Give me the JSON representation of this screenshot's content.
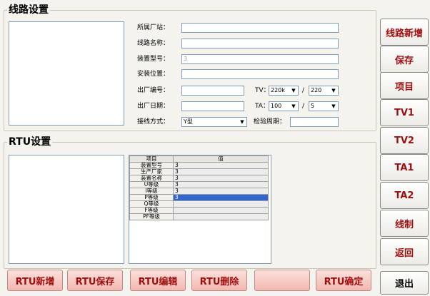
{
  "line_settings": {
    "title": "线路设置",
    "fields": {
      "plant_label": "所属厂站：",
      "line_name_label": "线路名称：",
      "device_model_label": "装置型号：",
      "device_model_value": "3",
      "install_location_label": "安装位置：",
      "factory_no_label": "出厂编号：",
      "factory_date_label": "出厂日期：",
      "wiring_label": "接线方式：",
      "wiring_value": "Y型",
      "tv_label": "TV：",
      "tv_primary": "220k",
      "tv_secondary": "220",
      "ta_label": "TA：",
      "ta_primary": "100",
      "ta_secondary": "5",
      "ratio_sep": "/",
      "inspection_label": "检验周期："
    }
  },
  "rtu_settings": {
    "title": "RTU设置",
    "grid": {
      "col_item": "项目",
      "col_value": "值",
      "rows": [
        {
          "item": "装置型号",
          "value": "3"
        },
        {
          "item": "生产厂家",
          "value": "3"
        },
        {
          "item": "装置名称",
          "value": "3"
        },
        {
          "item": "U等级",
          "value": "3"
        },
        {
          "item": "I等级",
          "value": "3"
        },
        {
          "item": "P等级",
          "value": "3"
        },
        {
          "item": "Q等级",
          "value": ""
        },
        {
          "item": "F等级",
          "value": ""
        },
        {
          "item": "PF等级",
          "value": ""
        }
      ]
    }
  },
  "bottom_buttons": {
    "rtu_add": "RTU新增",
    "rtu_save": "RTU保存",
    "rtu_edit": "RTU编辑",
    "rtu_delete": "RTU删除",
    "blank": "",
    "rtu_confirm": "RTU确定"
  },
  "side_buttons": {
    "line_add": "线路新增",
    "save": "保存",
    "item": "项目",
    "tv1": "TV1",
    "tv2": "TV2",
    "ta1": "TA1",
    "ta2": "TA2",
    "line_control": "线制",
    "back": "返回",
    "exit": "退出"
  },
  "colors": {
    "button_text": "#a01010",
    "pink_button": "#f2b8b0",
    "selection": "#3366cc"
  }
}
